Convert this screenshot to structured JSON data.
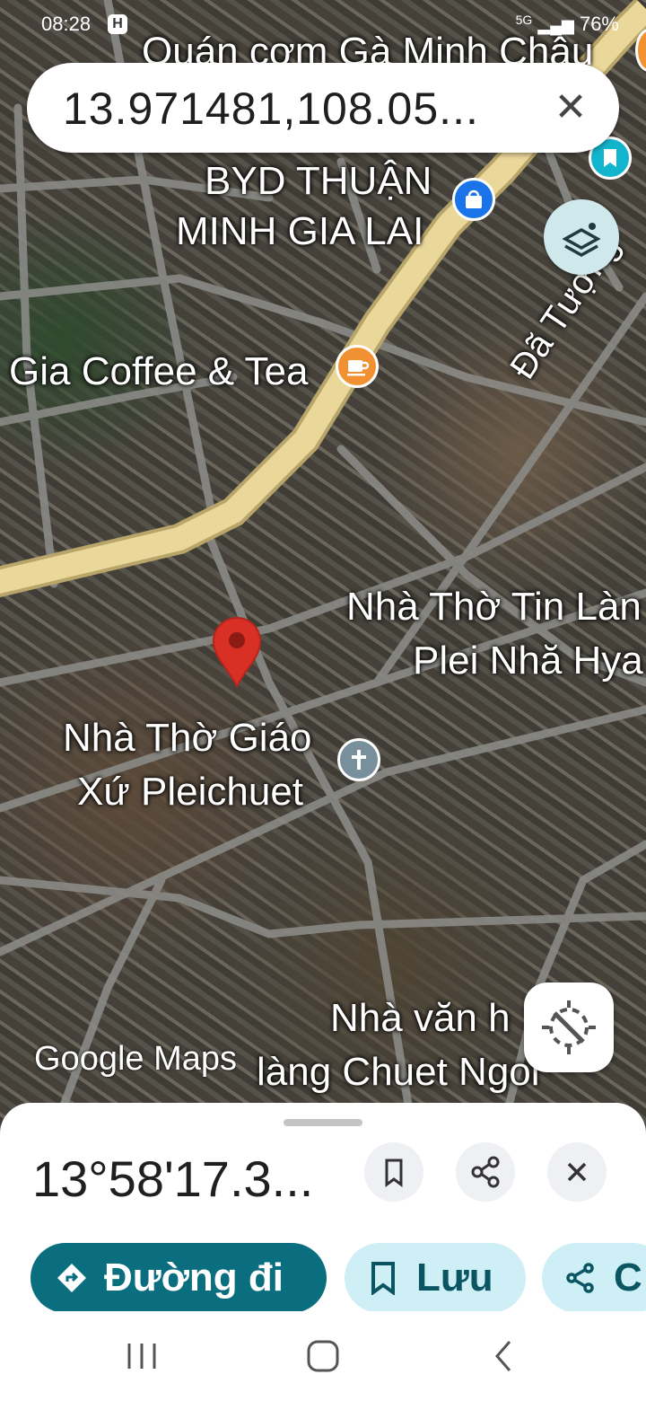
{
  "status_bar": {
    "time": "08:28",
    "app_icon": "H",
    "network": "5G",
    "battery": "76%"
  },
  "search": {
    "coordinates": "13.971481,108.05...",
    "close_icon": "close-icon"
  },
  "map": {
    "labels": {
      "quan_com": "Quán cơm Gà Minh Châu",
      "byd_line1": "BYD THUẬN",
      "byd_line2": "MINH GIA LAI",
      "gia_coffee": "Gia Coffee & Tea",
      "da_tuong": "Đã Tượng",
      "nha_tho_tin_lanh_line1": "Nhà Thờ Tin Làn",
      "nha_tho_tin_lanh_line2": "Plei Nhă Hya",
      "nha_tho_giao_xu_line1": "Nhà Thờ Giáo",
      "nha_tho_giao_xu_line2": "Xứ Pleichuet",
      "nha_van_hoa_line1": "Nhà văn h",
      "nha_van_hoa_line2": "làng Chuet Ngol"
    },
    "brand": "Google Maps",
    "colors": {
      "road_major": "#e6d08d",
      "pin": "#d93025",
      "coffee_poi": "#f29132",
      "shop_poi": "#1a73e8",
      "church_poi": "#78909c",
      "bookmark_poi": "#12b5cb"
    }
  },
  "sheet": {
    "dms": "13°58'17.3...",
    "pills": {
      "directions": "Đường đi",
      "save": "Lưu",
      "share": "C"
    },
    "colors": {
      "directions_bg": "#0b6e7f",
      "secondary_bg": "#cdeff5",
      "secondary_text": "#0b5563"
    }
  }
}
